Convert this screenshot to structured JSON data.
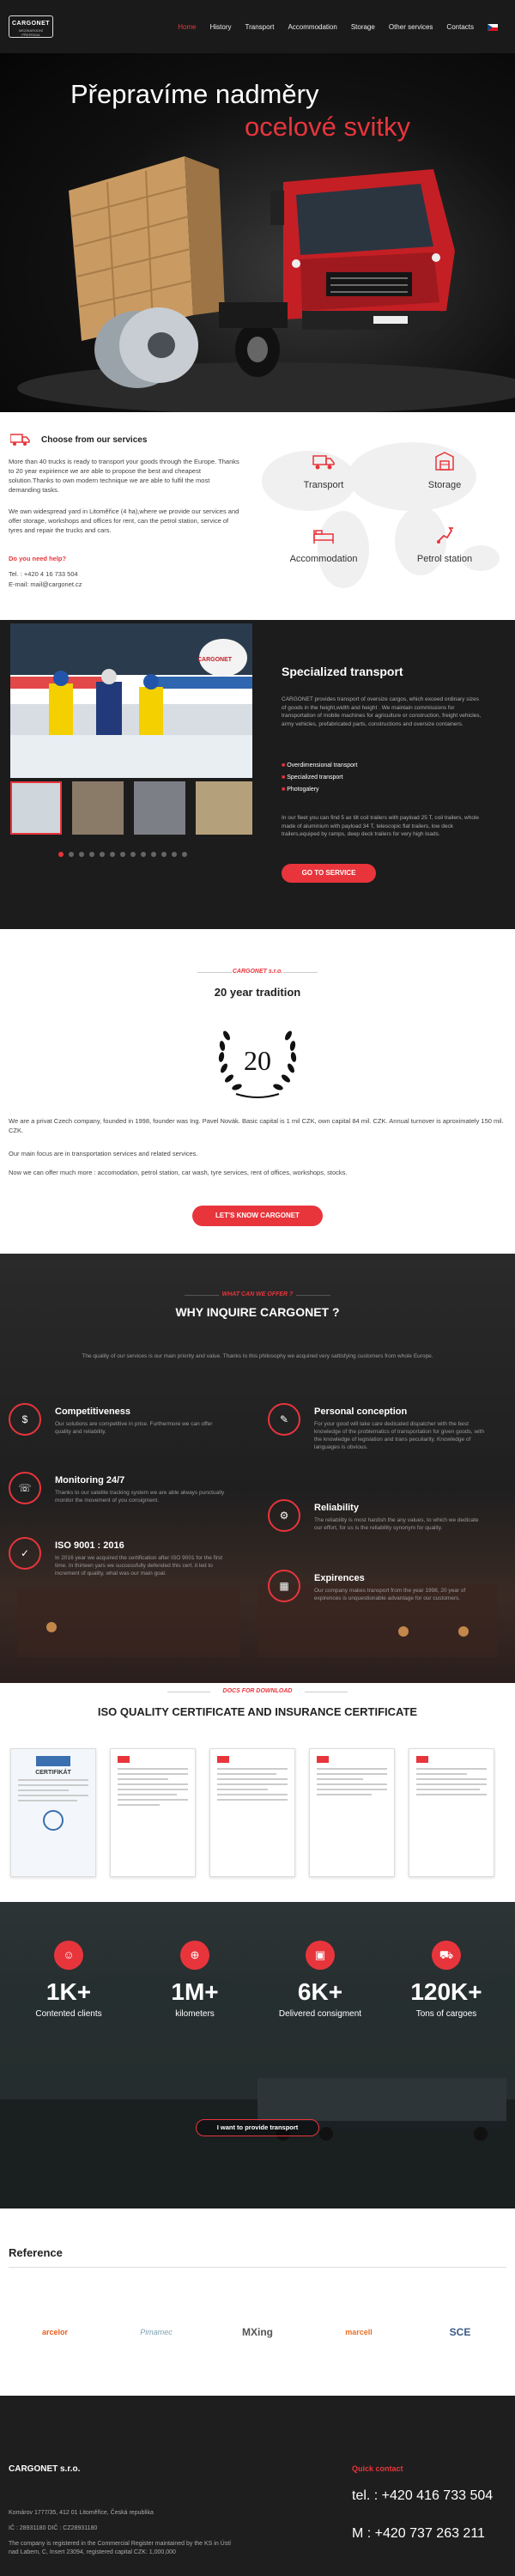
{
  "nav": {
    "logo": "CARGONET",
    "logo_sub": "MEZINÁRODNÍ PŘEPRAVA",
    "items": [
      {
        "label": "Home"
      },
      {
        "label": "History"
      },
      {
        "label": "Transport"
      },
      {
        "label": "Accommodation"
      },
      {
        "label": "Storage"
      },
      {
        "label": "Other services"
      },
      {
        "label": "Contacts"
      }
    ]
  },
  "hero": {
    "title_line1": "Přepravíme nadměry",
    "title_line2": "ocelové svitky"
  },
  "services": {
    "title": "Choose from our services",
    "para1": "More than 40 trucks is ready to transport your goods through the Europe. Thanks to 20 year expirience we are able to propose the best and cheapest solution.Thanks to own modern technique we are able to fulfil the most demanding tasks.",
    "para2": "We own widespread yard in Litoměřice (4 ha),where we provide our services and offer storage, workshops  and offices for rent, can the petrol station, service of tyres and repair the trucks and cars.",
    "help": "Do you need help?",
    "tel": "Tel. : +420 4 16 733 504",
    "email": "E-mail: mail@cargonet.cz",
    "cards": [
      {
        "label": "Transport"
      },
      {
        "label": "Storage"
      },
      {
        "label": "Accommodation"
      },
      {
        "label": "Petrol station"
      }
    ]
  },
  "spec": {
    "title": "Specialized transport",
    "text": "CARGONET provides transport of oversize cargos, which exceed ordinary sizes of goods in the height,width and height . We maintain commissions for transportation of mobile machines for agriculture or construction, freight vehicles, army vehicles, prefabricated parts, constructions and oversize containers.",
    "bullets": [
      "Overdimensional transport",
      "Specialized transport",
      "Photogalery"
    ],
    "text2": "In our fleet you can find 5 ax tilt coil trailers with payload 25 T, coil trailers, whole made of aluminium with payload 34 T, telescopic flat trailers, low deck trailers,equiped by ramps, deep deck trailers for very high loads.",
    "button": "GO TO SERVICE",
    "banner_text": "CARGONET"
  },
  "tradition": {
    "kicker": "CARGONET s.r.o.",
    "title": "20 year tradition",
    "badge": "20",
    "para1": "We are a privat Czech company, founded in 1998, founder was Ing. Pavel Novák. Basic capital is  1 mil CZK, own capital 84 mil. CZK. Annual turnover is aproximately 150 mil. CZK.",
    "para2": "Our main focus are in transportation services and related services.",
    "para3": "Now we can offer much more : accomodation, petrol station, car wash, tyre services, rent of  offices, workshops, stocks.",
    "button": "LET'S  KNOW CARGONET"
  },
  "why": {
    "kicker": "WHAT CAN WE OFFER ?",
    "title": "WHY INQUIRE CARGONET ?",
    "intro": "The quality of our services is our main priority and value. Thanks to this philosophy we acquired very sattisfying customers from whole Europe.",
    "items": [
      {
        "icon": "dollar-icon",
        "title": "Competitiveness",
        "text": "Our solutions are competitive in price. Furthermore we can offer quality and reliability."
      },
      {
        "icon": "wrench-icon",
        "title": "Personal conception",
        "text": "For your good will take care dedicated dispatcher with the best knowledge of the problematics of transportation for given goods, with the knowledge of legislation and trans peculiarity. Knowledge of languages is obvious."
      },
      {
        "icon": "headset-icon",
        "title": "Monitoring 24/7",
        "text": "Thanks to our satelite tracking system we are able always punctually monitor the movement of you consigment."
      },
      {
        "icon": "gear-icon",
        "title": "Reliability",
        "text": "The reliability is most hardish the any values, to which we dedicate our effort, for us is the reliability synonym for quality."
      },
      {
        "icon": "certificate-icon",
        "title": "ISO 9001 : 2016",
        "text": "In 2016 year we acquired the certification after ISO 9001 for the first time. In thirteen yars we successfully defended this cert. it led to increment of quality, what was our main goal."
      },
      {
        "icon": "building-icon",
        "title": "Expirences",
        "text": "Our company makes transport from the year 1998, 20 year of expirences is unquestionable advantage for our customers."
      }
    ]
  },
  "certs": {
    "kicker": "DOCS FOR DOWNLOAD",
    "title": "ISO QUALITY CERTIFICATE AND INSURANCE CERTIFICATE",
    "cert_heading": "CERTIFIKÁT"
  },
  "stats": {
    "items": [
      {
        "icon": "person-icon",
        "number": "1K+",
        "label": "Contented clients"
      },
      {
        "icon": "road-icon",
        "number": "1M+",
        "label": "kilometers"
      },
      {
        "icon": "box-icon",
        "number": "6K+",
        "label": "Delivered consigment"
      },
      {
        "icon": "truck-icon",
        "number": "120K+",
        "label": "Tons of cargoes"
      }
    ],
    "button": "I want to provide transport"
  },
  "refs": {
    "title": "Reference",
    "logos": [
      {
        "name": "arcelor",
        "color": "#e85d20"
      },
      {
        "name": "Pimamec",
        "color": "#7aa0b0"
      },
      {
        "name": "MXing",
        "color": "#555555"
      },
      {
        "name": "marcell",
        "color": "#e8702a"
      },
      {
        "name": "SCE",
        "color": "#3a5a8a"
      }
    ]
  },
  "footer": {
    "company": "CARGONET s.r.o.",
    "address": "Komárov 1777/35, 412 01 Litoměřice, Česká republika",
    "ids": "IČ : 28931180 DIČ : CZ28931180",
    "reg": "The company is registered in the Commercial Register maintained by the KS in Ústí nad Labem, C, Insert 23094, registered capital CZK: 1,000,000",
    "contact_title": "Quick contact",
    "tel": "tel. : +420 416 733 504",
    "mobile": "M   : +420 737 263 211"
  },
  "colors": {
    "accent": "#e8353c",
    "dark": "#1c1c1c"
  }
}
